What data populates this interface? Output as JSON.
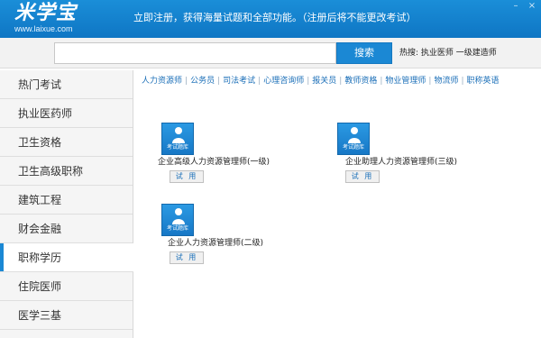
{
  "header": {
    "logo_main": "米学宝",
    "logo_sub": "www.laixue.com",
    "notice": "立即注册，获得海量试题和全部功能。（注册后将不能更改考试）"
  },
  "search": {
    "input_value": "",
    "button_label": "搜索",
    "hot_text": "热搜: 执业医师 一级建造师"
  },
  "sidebar": {
    "items": [
      {
        "label": "热门考试"
      },
      {
        "label": "执业医药师"
      },
      {
        "label": "卫生资格"
      },
      {
        "label": "卫生高级职称"
      },
      {
        "label": "建筑工程"
      },
      {
        "label": "财会金融"
      },
      {
        "label": "职称学历"
      },
      {
        "label": "住院医师"
      },
      {
        "label": "医学三基"
      }
    ],
    "active_index": 6
  },
  "main": {
    "categories": [
      "人力资源师",
      "公务员",
      "司法考试",
      "心理咨询师",
      "报关员",
      "教师资格",
      "物业管理师",
      "物流师",
      "职称英语"
    ],
    "badge_label": "考试题库",
    "try_label": "试 用",
    "exams": [
      {
        "title": "企业高级人力资源管理师(一级)"
      },
      {
        "title": "企业助理人力资源管理师(三级)"
      },
      {
        "title": "企业人力资源管理师(二级)"
      }
    ]
  }
}
